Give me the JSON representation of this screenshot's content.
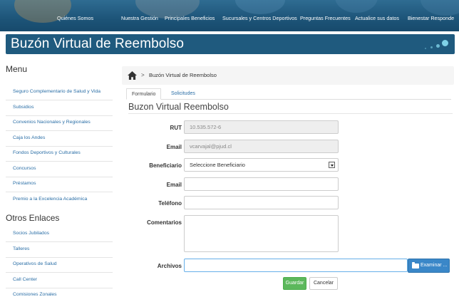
{
  "nav": {
    "links": [
      "Quiénes Somos",
      "Nuestra Gestión",
      "Principales Beneficios",
      "Sucursales y Centros Deportivos",
      "Preguntas Frecuentes",
      "Actualice sus datos",
      "Bienestar Responde"
    ]
  },
  "banner": {
    "title": "Buzón Virtual de Reembolso"
  },
  "sidebar": {
    "menu_heading": "Menu",
    "menu_items": [
      "Seguro Complementario de Salud y Vida",
      "Subsidios",
      "Convenios Nacionales y Regionales",
      "Caja los Andes",
      "Fondos Deportivos y Culturales",
      "Concursos",
      "Préstamos",
      "Premio a la Excelencia Académica"
    ],
    "other_heading": "Otros Enlaces",
    "other_items": [
      "Socios Jubilados",
      "Talleres",
      "Operativos de Salud",
      "Call Center",
      "Comisiones Zonales"
    ]
  },
  "breadcrumb": {
    "separator": ">",
    "current": "Buzón Virtual de Reembolso"
  },
  "tabs": [
    "Formulario",
    "Solicitudes"
  ],
  "form": {
    "title": "Buzon Virtual Reembolso",
    "rut_label": "RUT",
    "rut_value": "10.535.572-6",
    "email_label": "Email",
    "email_value": "vcarvajal@pjud.cl",
    "beneficiario_label": "Beneficiario",
    "beneficiario_selected": "Seleccione Beneficiario",
    "email2_label": "Email",
    "telefono_label": "Teléfono",
    "comentarios_label": "Comentarios",
    "archivos_label": "Archivos",
    "examinar_label": "Examinar ...",
    "guardar_label": "Guardar",
    "cancelar_label": "Cancelar"
  },
  "colors": {
    "nav_bg": "#1d5478",
    "banner_bg": "#1f5a7e",
    "link": "#2a6ea6",
    "save": "#5cb85c",
    "browse": "#3a87c8"
  },
  "icons": [
    "home-icon",
    "folder-open-icon",
    "chevron-down-icon"
  ]
}
